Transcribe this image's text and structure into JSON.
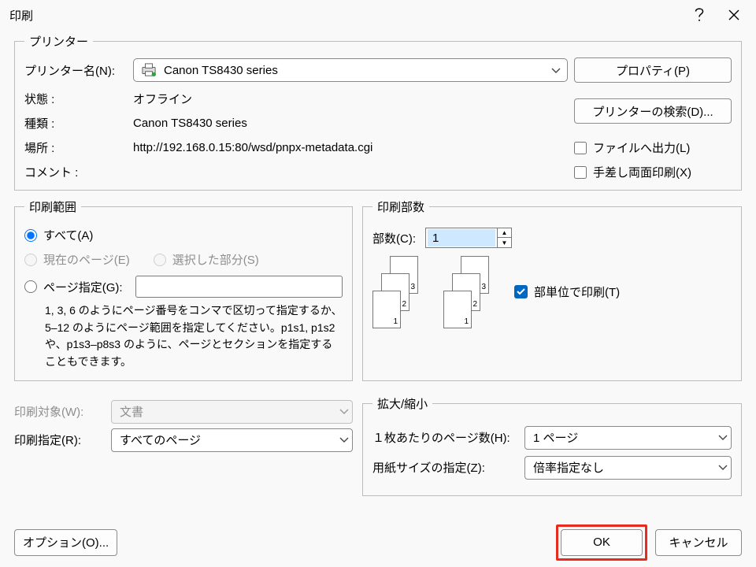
{
  "title": "印刷",
  "printer": {
    "legend": "プリンター",
    "name_label": "プリンター名(N):",
    "name_value": "Canon TS8430 series",
    "status_label": "状態 :",
    "status_value": "オフライン",
    "type_label": "種類 :",
    "type_value": "Canon TS8430 series",
    "location_label": "場所 :",
    "location_value": "http://192.168.0.15:80/wsd/pnpx-metadata.cgi",
    "comment_label": "コメント :",
    "properties_btn": "プロパティ(P)",
    "find_printer_btn": "プリンターの検索(D)...",
    "to_file": "ファイルへ出力(L)",
    "manual_duplex": "手差し両面印刷(X)"
  },
  "range": {
    "legend": "印刷範囲",
    "all": "すべて(A)",
    "current": "現在のページ(E)",
    "selection": "選択した部分(S)",
    "pages": "ページ指定(G):",
    "hint": "1, 3, 6 のようにページ番号をコンマで区切って指定するか、5–12 のようにページ範囲を指定してください。p1s1, p1s2 や、p1s3–p8s3 のように、ページとセクションを指定することもできます。"
  },
  "copies": {
    "legend": "印刷部数",
    "count_label": "部数(C):",
    "count_value": "1",
    "collate": "部単位で印刷(T)"
  },
  "bottom": {
    "target_label": "印刷対象(W):",
    "target_value": "文書",
    "spec_label": "印刷指定(R):",
    "spec_value": "すべてのページ"
  },
  "zoom": {
    "legend": "拡大/縮小",
    "pps_label": "１枚あたりのページ数(H):",
    "pps_value": "1 ページ",
    "paper_label": "用紙サイズの指定(Z):",
    "paper_value": "倍率指定なし"
  },
  "footer": {
    "options": "オプション(O)...",
    "ok": "OK",
    "cancel": "キャンセル"
  }
}
